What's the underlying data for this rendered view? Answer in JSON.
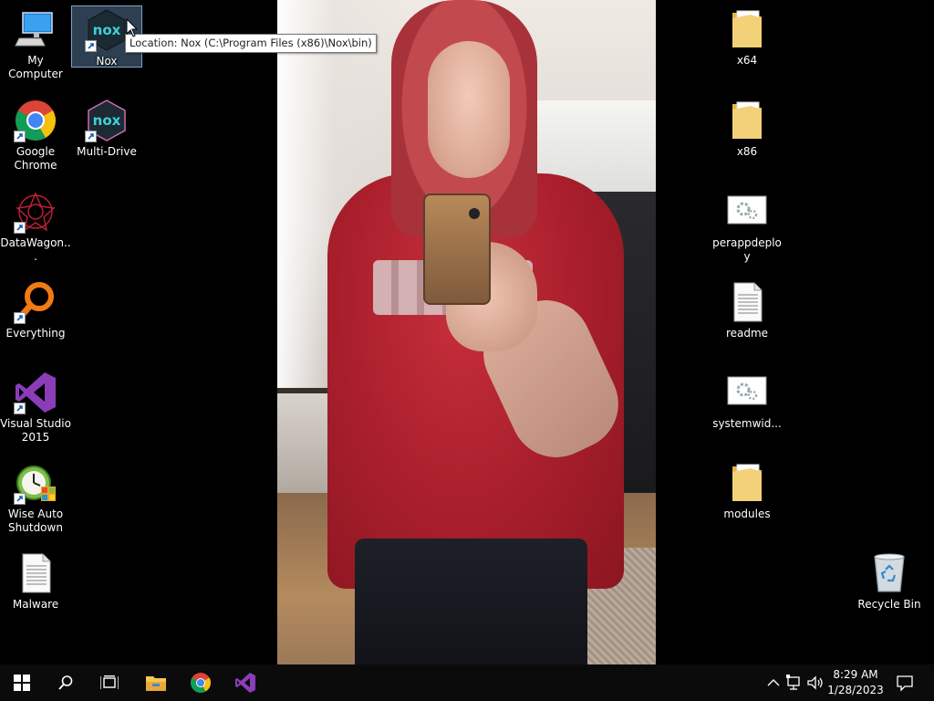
{
  "desktop": {
    "left_icons": [
      {
        "name": "my-computer",
        "label": "My Computer",
        "shortcut": false
      },
      {
        "name": "nox",
        "label": "Nox",
        "shortcut": true,
        "selected": true
      },
      {
        "name": "google-chrome",
        "label": "Google Chrome",
        "shortcut": true
      },
      {
        "name": "multi-drive",
        "label": "Multi-Drive",
        "shortcut": true
      },
      {
        "name": "datawagon",
        "label": "DataWagon...",
        "shortcut": true
      },
      {
        "name": "everything",
        "label": "Everything",
        "shortcut": true
      },
      {
        "name": "visual-studio-2015",
        "label": "Visual Studio 2015",
        "shortcut": true
      },
      {
        "name": "wise-auto-shutdown",
        "label": "Wise Auto Shutdown",
        "shortcut": true
      },
      {
        "name": "malware",
        "label": "Malware",
        "shortcut": false
      }
    ],
    "right_icons": [
      {
        "name": "x64",
        "label": "x64"
      },
      {
        "name": "x86",
        "label": "x86"
      },
      {
        "name": "perappdeploy",
        "label": "perappdeploy"
      },
      {
        "name": "readme",
        "label": "readme"
      },
      {
        "name": "systemwid",
        "label": "systemwid..."
      },
      {
        "name": "modules",
        "label": "modules"
      },
      {
        "name": "recycle-bin",
        "label": "Recycle Bin"
      }
    ]
  },
  "tooltip": {
    "text": "Location: Nox (C:\\Program Files (x86)\\Nox\\bin)"
  },
  "taskbar": {
    "buttons": [
      "start-icon",
      "search-icon",
      "task-view-icon",
      "file-explorer-icon",
      "chrome-icon",
      "visual-studio-icon"
    ],
    "tray": [
      "show-hidden-icons-icon",
      "network-icon",
      "volume-icon",
      "notifications-icon"
    ],
    "clock": {
      "time": "8:29 AM",
      "date": "1/28/2023"
    }
  },
  "colors": {
    "accent_folder": "#f3c94f",
    "chrome_red": "#db4437",
    "vs_purple": "#68217a",
    "taskbar": "#0b0b0b"
  }
}
